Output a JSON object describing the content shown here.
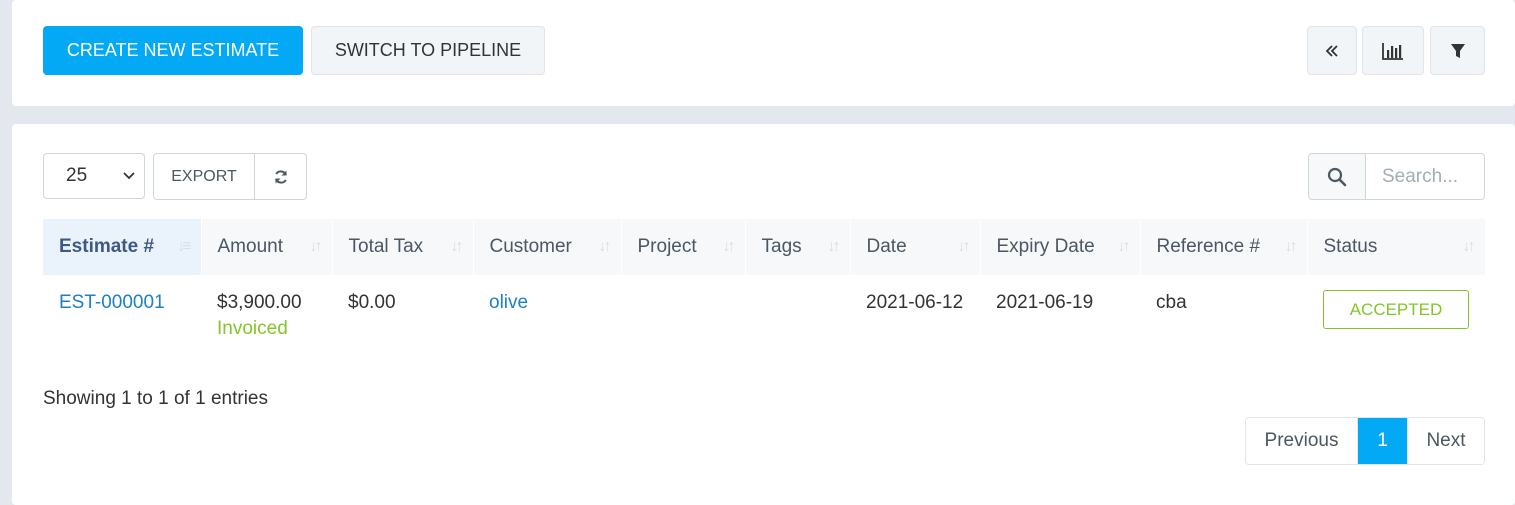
{
  "toolbar": {
    "create_label": "CREATE NEW ESTIMATE",
    "switch_label": "SWITCH TO PIPELINE"
  },
  "controls": {
    "page_length": "25",
    "export_label": "EXPORT",
    "search_placeholder": "Search..."
  },
  "table": {
    "headers": [
      "Estimate #",
      "Amount",
      "Total Tax",
      "Customer",
      "Project",
      "Tags",
      "Date",
      "Expiry Date",
      "Reference #",
      "Status"
    ],
    "rows": [
      {
        "estimate": "EST-000001",
        "amount": "$3,900.00",
        "amount_note": "Invoiced",
        "total_tax": "$0.00",
        "customer": "olive",
        "project": "",
        "tags": "",
        "date": "2021-06-12",
        "expiry_date": "2021-06-19",
        "reference": "cba",
        "status": "ACCEPTED"
      }
    ]
  },
  "footer": {
    "info": "Showing 1 to 1 of 1 entries",
    "prev_label": "Previous",
    "current_page": "1",
    "next_label": "Next"
  },
  "icons": {
    "collapse": "double-chevron-left-icon",
    "chart": "bar-chart-icon",
    "filter": "filter-icon",
    "refresh": "refresh-icon",
    "search": "search-icon"
  },
  "colors": {
    "primary": "#03a9f4",
    "link": "#1d7fc4",
    "success": "#84c529"
  }
}
